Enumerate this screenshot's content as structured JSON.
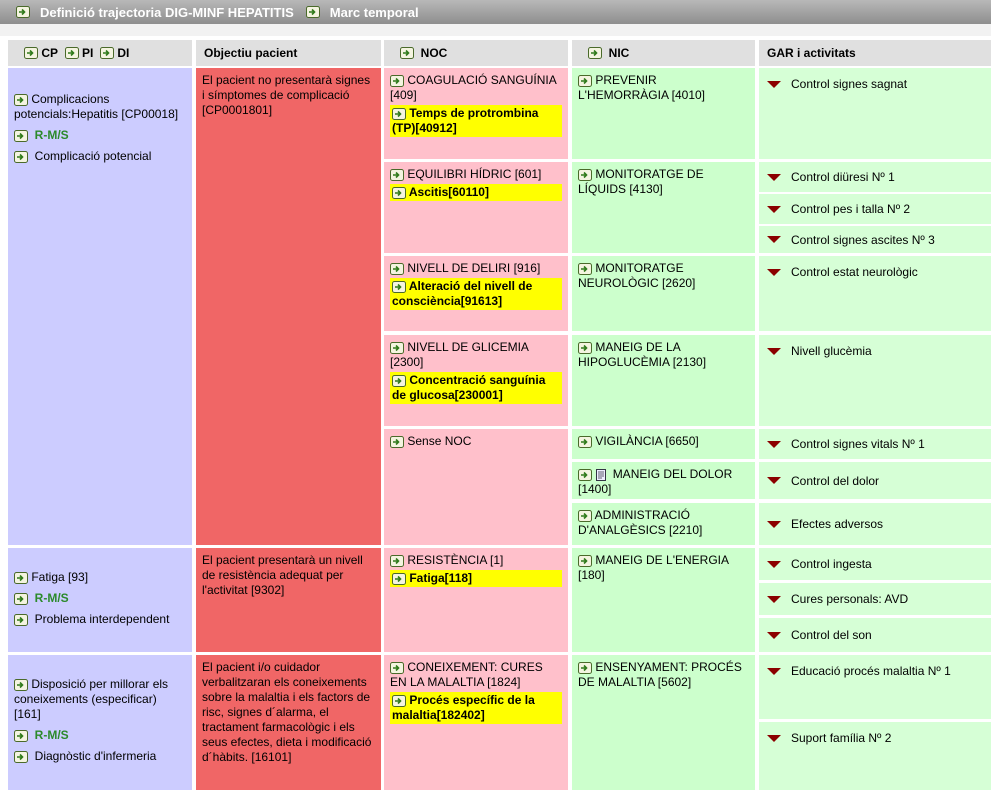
{
  "titlebar": {
    "title": "Definició trajectoria DIG-MINF HEPATITIS",
    "subtitle": "Marc temporal"
  },
  "headers": {
    "cp": "CP",
    "pi": "PI",
    "di": "DI",
    "objectiu": "Objectiu pacient",
    "noc": "NOC",
    "nic": "NIC",
    "gar": "GAR i activitats"
  },
  "problems": [
    {
      "name": "Complicacions potencials:Hepatitis [CP00018]",
      "rms": "R-M/S",
      "type": "Complicació potencial",
      "objective": "El pacient no presentarà signes i símptomes de complicació [CP0001801]"
    },
    {
      "name": "Fatiga [93]",
      "rms": "R-M/S",
      "type": "Problema interdependent",
      "objective": "El pacient presentarà un nivell de resistència adequat per l'activitat [9302]"
    },
    {
      "name": "Disposició per millorar els coneixements (especificar) [161]",
      "rms": "R-M/S",
      "type": "Diagnòstic d'infermeria",
      "objective": "El pacient i/o cuidador verbalitzaran els coneixements sobre la malaltia i els factors de risc, signes d´alarma, el tractament farmacològic i els seus efectes, dieta i modificació d´hàbits. [16101]"
    }
  ],
  "noc": [
    {
      "title": "COAGULACIÓ SANGUÍNIA [409]",
      "indicator": "Temps de protrombina (TP)[40912]"
    },
    {
      "title": "EQUILIBRI HÍDRIC [601]",
      "indicator": "Ascitis[60110]"
    },
    {
      "title": "NIVELL DE DELIRI [916]",
      "indicator": "Alteració del nivell de consciència[91613]"
    },
    {
      "title": "NIVELL DE GLICEMIA [2300]",
      "indicator": "Concentració sanguínia de glucosa[230001]"
    },
    {
      "title": "Sense NOC",
      "indicator": ""
    },
    {
      "title": "RESISTÈNCIA [1]",
      "indicator": "Fatiga[118]"
    },
    {
      "title": "CONEIXEMENT: CURES EN LA MALALTIA [1824]",
      "indicator": "Procés específic de la malaltia[182402]"
    }
  ],
  "nic": [
    {
      "text": "PREVENIR L'HEMORRÀGIA [4010]"
    },
    {
      "text": "MONITORATGE DE LÍQUIDS [4130]"
    },
    {
      "text": "MONITORATGE NEUROLÒGIC [2620]"
    },
    {
      "text": "MANEIG DE LA HIPOGLUCÈMIA [2130]"
    },
    {
      "text": "VIGILÀNCIA [6650]"
    },
    {
      "text": "MANEIG DEL DOLOR [1400]"
    },
    {
      "text": "ADMINISTRACIÓ D'ANALGÈSICS [2210]"
    },
    {
      "text": "MANEIG DE L'ENERGIA [180]"
    },
    {
      "text": "ENSENYAMENT: PROCÉS DE MALALTIA [5602]"
    }
  ],
  "activities": [
    "Control signes sagnat",
    "Control diüresi Nº 1",
    "Control pes i talla Nº 2",
    "Control signes ascites Nº 3",
    "Control estat neurològic",
    "Nivell glucèmia",
    "Control signes vitals Nº 1",
    "Control del dolor",
    "Efectes adversos",
    "Control ingesta",
    "Cures personals: AVD",
    "Control del son",
    "Educació procés malaltia Nº 1",
    "Suport família Nº 2"
  ],
  "colors": {
    "lavender": "#ccccff",
    "red": "#f06666",
    "pink": "#ffc0cb",
    "green": "#ccffcc",
    "yellow": "#ffff00",
    "triangle": "#8b0000"
  }
}
